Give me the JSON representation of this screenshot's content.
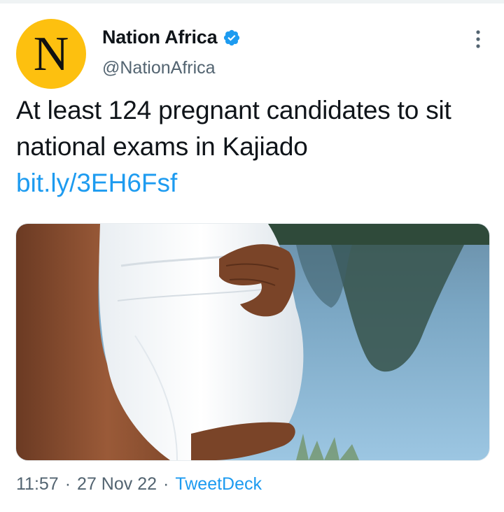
{
  "author": {
    "avatar_letter": "N",
    "avatar_color": "#fdc00f",
    "display_name": "Nation Africa",
    "verified": true,
    "verified_color": "#1d9bf0",
    "handle": "@NationAfrica"
  },
  "tweet": {
    "text": "At least 124 pregnant candidates to sit national exams in Kajiado",
    "link": "bit.ly/3EH6Fsf",
    "link_color": "#1d9bf0"
  },
  "media": {
    "type": "photo",
    "icon": "photo-pregnant-woman-by-lake"
  },
  "meta": {
    "time": "11:57",
    "separator": "·",
    "date": "27 Nov 22",
    "source": "TweetDeck"
  },
  "icons": {
    "verified": "verified-badge-icon",
    "more": "more-vertical-icon"
  }
}
